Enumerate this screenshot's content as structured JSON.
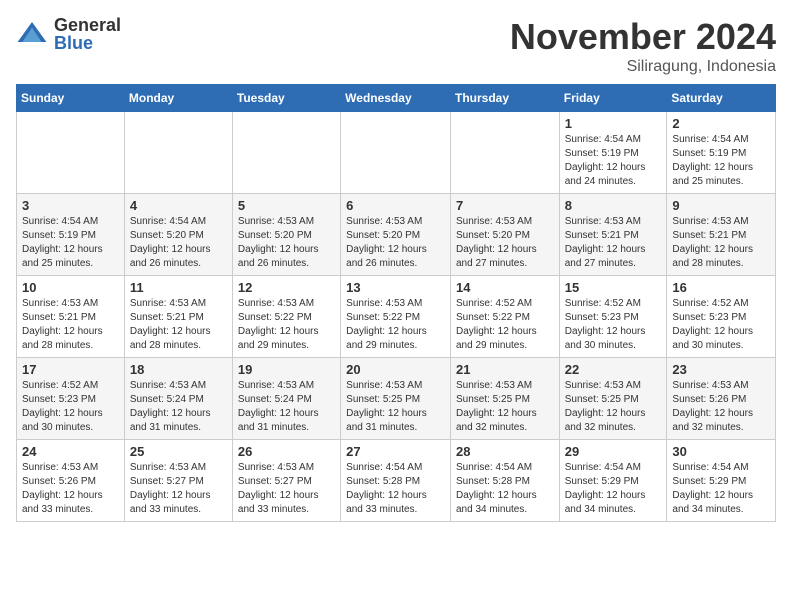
{
  "logo": {
    "general": "General",
    "blue": "Blue"
  },
  "title": "November 2024",
  "location": "Siliragung, Indonesia",
  "days_of_week": [
    "Sunday",
    "Monday",
    "Tuesday",
    "Wednesday",
    "Thursday",
    "Friday",
    "Saturday"
  ],
  "weeks": [
    [
      {
        "day": "",
        "info": ""
      },
      {
        "day": "",
        "info": ""
      },
      {
        "day": "",
        "info": ""
      },
      {
        "day": "",
        "info": ""
      },
      {
        "day": "",
        "info": ""
      },
      {
        "day": "1",
        "info": "Sunrise: 4:54 AM\nSunset: 5:19 PM\nDaylight: 12 hours and 24 minutes."
      },
      {
        "day": "2",
        "info": "Sunrise: 4:54 AM\nSunset: 5:19 PM\nDaylight: 12 hours and 25 minutes."
      }
    ],
    [
      {
        "day": "3",
        "info": "Sunrise: 4:54 AM\nSunset: 5:19 PM\nDaylight: 12 hours and 25 minutes."
      },
      {
        "day": "4",
        "info": "Sunrise: 4:54 AM\nSunset: 5:20 PM\nDaylight: 12 hours and 26 minutes."
      },
      {
        "day": "5",
        "info": "Sunrise: 4:53 AM\nSunset: 5:20 PM\nDaylight: 12 hours and 26 minutes."
      },
      {
        "day": "6",
        "info": "Sunrise: 4:53 AM\nSunset: 5:20 PM\nDaylight: 12 hours and 26 minutes."
      },
      {
        "day": "7",
        "info": "Sunrise: 4:53 AM\nSunset: 5:20 PM\nDaylight: 12 hours and 27 minutes."
      },
      {
        "day": "8",
        "info": "Sunrise: 4:53 AM\nSunset: 5:21 PM\nDaylight: 12 hours and 27 minutes."
      },
      {
        "day": "9",
        "info": "Sunrise: 4:53 AM\nSunset: 5:21 PM\nDaylight: 12 hours and 28 minutes."
      }
    ],
    [
      {
        "day": "10",
        "info": "Sunrise: 4:53 AM\nSunset: 5:21 PM\nDaylight: 12 hours and 28 minutes."
      },
      {
        "day": "11",
        "info": "Sunrise: 4:53 AM\nSunset: 5:21 PM\nDaylight: 12 hours and 28 minutes."
      },
      {
        "day": "12",
        "info": "Sunrise: 4:53 AM\nSunset: 5:22 PM\nDaylight: 12 hours and 29 minutes."
      },
      {
        "day": "13",
        "info": "Sunrise: 4:53 AM\nSunset: 5:22 PM\nDaylight: 12 hours and 29 minutes."
      },
      {
        "day": "14",
        "info": "Sunrise: 4:52 AM\nSunset: 5:22 PM\nDaylight: 12 hours and 29 minutes."
      },
      {
        "day": "15",
        "info": "Sunrise: 4:52 AM\nSunset: 5:23 PM\nDaylight: 12 hours and 30 minutes."
      },
      {
        "day": "16",
        "info": "Sunrise: 4:52 AM\nSunset: 5:23 PM\nDaylight: 12 hours and 30 minutes."
      }
    ],
    [
      {
        "day": "17",
        "info": "Sunrise: 4:52 AM\nSunset: 5:23 PM\nDaylight: 12 hours and 30 minutes."
      },
      {
        "day": "18",
        "info": "Sunrise: 4:53 AM\nSunset: 5:24 PM\nDaylight: 12 hours and 31 minutes."
      },
      {
        "day": "19",
        "info": "Sunrise: 4:53 AM\nSunset: 5:24 PM\nDaylight: 12 hours and 31 minutes."
      },
      {
        "day": "20",
        "info": "Sunrise: 4:53 AM\nSunset: 5:25 PM\nDaylight: 12 hours and 31 minutes."
      },
      {
        "day": "21",
        "info": "Sunrise: 4:53 AM\nSunset: 5:25 PM\nDaylight: 12 hours and 32 minutes."
      },
      {
        "day": "22",
        "info": "Sunrise: 4:53 AM\nSunset: 5:25 PM\nDaylight: 12 hours and 32 minutes."
      },
      {
        "day": "23",
        "info": "Sunrise: 4:53 AM\nSunset: 5:26 PM\nDaylight: 12 hours and 32 minutes."
      }
    ],
    [
      {
        "day": "24",
        "info": "Sunrise: 4:53 AM\nSunset: 5:26 PM\nDaylight: 12 hours and 33 minutes."
      },
      {
        "day": "25",
        "info": "Sunrise: 4:53 AM\nSunset: 5:27 PM\nDaylight: 12 hours and 33 minutes."
      },
      {
        "day": "26",
        "info": "Sunrise: 4:53 AM\nSunset: 5:27 PM\nDaylight: 12 hours and 33 minutes."
      },
      {
        "day": "27",
        "info": "Sunrise: 4:54 AM\nSunset: 5:28 PM\nDaylight: 12 hours and 33 minutes."
      },
      {
        "day": "28",
        "info": "Sunrise: 4:54 AM\nSunset: 5:28 PM\nDaylight: 12 hours and 34 minutes."
      },
      {
        "day": "29",
        "info": "Sunrise: 4:54 AM\nSunset: 5:29 PM\nDaylight: 12 hours and 34 minutes."
      },
      {
        "day": "30",
        "info": "Sunrise: 4:54 AM\nSunset: 5:29 PM\nDaylight: 12 hours and 34 minutes."
      }
    ]
  ]
}
